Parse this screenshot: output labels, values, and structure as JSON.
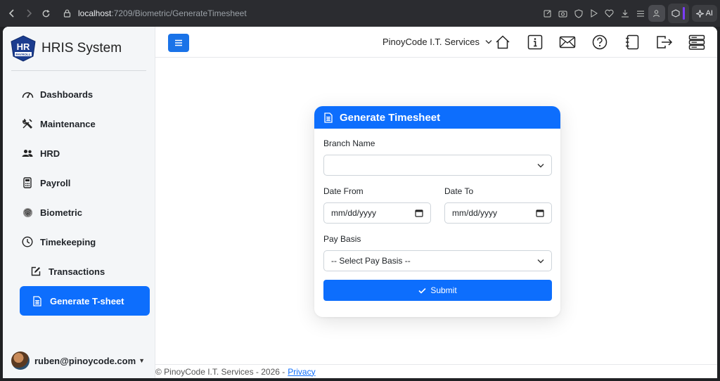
{
  "browser": {
    "url_host": "localhost",
    "url_path": ":7209/Biometric/GenerateTimesheet",
    "ai_label": "AI"
  },
  "brand": {
    "logo_text": "HR",
    "logo_subtext": "PAYROLL",
    "app_name": "HRIS System"
  },
  "sidebar": {
    "items": [
      {
        "label": "Dashboards",
        "icon": "speedometer-icon"
      },
      {
        "label": "Maintenance",
        "icon": "tools-icon"
      },
      {
        "label": "HRD",
        "icon": "people-icon"
      },
      {
        "label": "Payroll",
        "icon": "calculator-icon"
      },
      {
        "label": "Biometric",
        "icon": "fingerprint-icon"
      },
      {
        "label": "Timekeeping",
        "icon": "clock-icon"
      },
      {
        "label": "Transactions",
        "icon": "pencil-square-icon"
      },
      {
        "label": "Generate T-sheet",
        "icon": "spreadsheet-icon",
        "active": true
      }
    ]
  },
  "user": {
    "email": "ruben@pinoycode.com"
  },
  "topbar": {
    "company": "PinoyCode I.T. Services",
    "icons": [
      "home-icon",
      "info-icon",
      "mail-icon",
      "help-icon",
      "notebook-icon",
      "logout-icon",
      "server-icon"
    ]
  },
  "form": {
    "title": "Generate Timesheet",
    "branch_label": "Branch Name",
    "branch_value": "",
    "date_from_label": "Date From",
    "date_from_placeholder": "mm/dd/yyyy",
    "date_to_label": "Date To",
    "date_to_placeholder": "mm/dd/yyyy",
    "pay_basis_label": "Pay Basis",
    "pay_basis_value": "-- Select Pay Basis --",
    "submit_label": "Submit"
  },
  "footer": {
    "text": "© PinoyCode I.T. Services - 2026 -",
    "privacy_label": "Privacy"
  },
  "colors": {
    "primary": "#0d6efd",
    "sidebar_bg": "#f4f6f8",
    "browser_chrome": "#2b2c30"
  }
}
